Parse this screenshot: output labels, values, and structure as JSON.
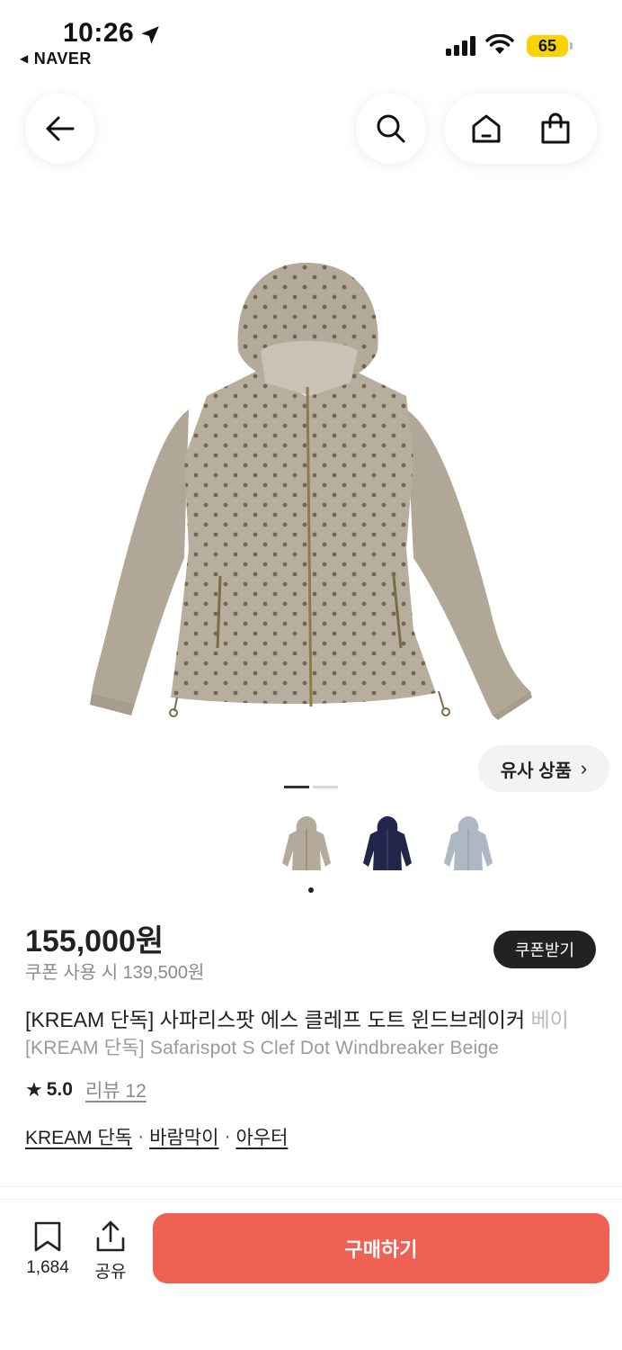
{
  "status_bar": {
    "time": "10:26",
    "back_app": "NAVER",
    "battery": "65",
    "icons": [
      "location-arrow-icon",
      "signal-icon",
      "wifi-icon",
      "battery-icon"
    ]
  },
  "nav": {
    "icons": [
      "back-arrow-icon",
      "search-icon",
      "home-icon",
      "shopping-bag-icon"
    ]
  },
  "gallery": {
    "similar_label": "유사 상품",
    "similar_chevron": "›",
    "pages": 2,
    "active_page": 1,
    "thumbnails": [
      "beige-jacket",
      "navy-jacket",
      "gray-jacket"
    ]
  },
  "product": {
    "price": "155,000원",
    "coupon_price": "쿠폰 사용 시 139,500원",
    "coupon_button": "쿠폰받기",
    "title_ko": "[KREAM 단독] 사파리스팟 에스 클레프 도트 윈드브레이커 ",
    "title_ko_fade": "베이",
    "title_en": "[KREAM 단독] Safarispot S Clef Dot Windbreaker Beige",
    "rating": "5.0",
    "review": "리뷰 12",
    "tags": [
      "KREAM 단독",
      "바람막이",
      "아우터"
    ],
    "tag_separator": "·"
  },
  "bottom_bar": {
    "bookmark_count": "1,684",
    "share_label": "공유",
    "buy_button": "구매하기"
  },
  "colors": {
    "accent": "#ef6253",
    "battery": "#f7d400",
    "jacket_beige": "#b3aa9c",
    "jacket_navy": "#22264a",
    "jacket_gray": "#aeb7c4"
  }
}
